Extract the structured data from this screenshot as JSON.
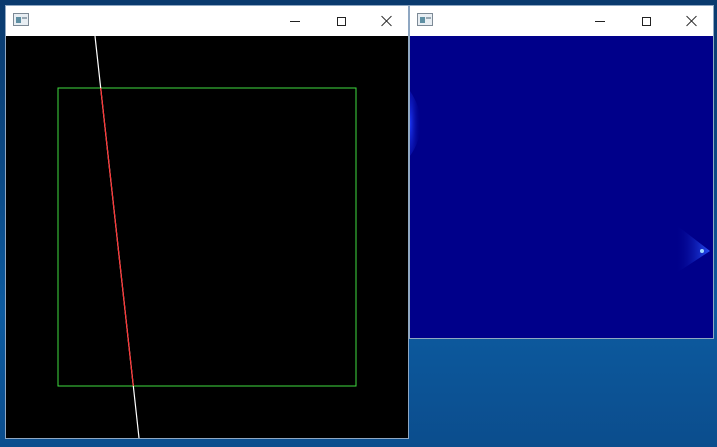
{
  "desktop": {
    "background_color": "#0b4a86"
  },
  "window_left": {
    "title": "",
    "controls": {
      "minimize_icon": "minimize-icon",
      "maximize_icon": "maximize-icon",
      "close_icon": "close-icon"
    },
    "canvas": {
      "background": "#000000",
      "rect_color": "#3fdc3f",
      "line_color": "#ffffff",
      "segment_color": "#ff3030"
    }
  },
  "window_right": {
    "title": "",
    "controls": {
      "minimize_icon": "minimize-icon",
      "maximize_icon": "maximize-icon",
      "close_icon": "close-icon"
    },
    "canvas": {
      "background": "#00008a",
      "accent_color": "#1a3cff"
    }
  }
}
